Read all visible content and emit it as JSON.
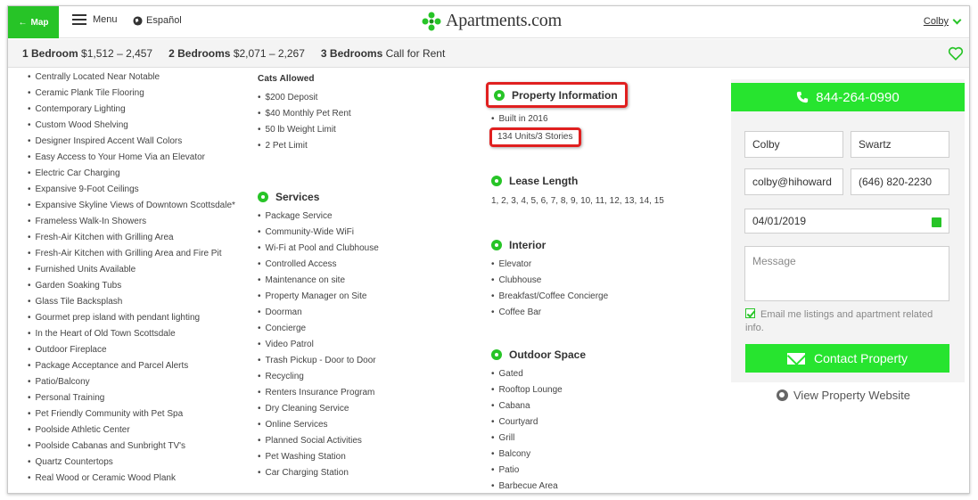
{
  "header": {
    "map_label": "Map",
    "menu_label": "Menu",
    "lang_label": "Español",
    "logo_text": "Apartments.com",
    "user_name": "Colby"
  },
  "pricebar": {
    "items": [
      {
        "label": "1 Bedroom",
        "value": "$1,512 – 2,457"
      },
      {
        "label": "2 Bedrooms",
        "value": "$2,071 – 2,267"
      },
      {
        "label": "3 Bedrooms",
        "value": "Call for Rent"
      }
    ]
  },
  "features": [
    "Centrally Located Near Notable",
    "Ceramic Plank Tile Flooring",
    "Contemporary Lighting",
    "Custom Wood Shelving",
    "Designer Inspired Accent Wall Colors",
    "Easy Access to Your Home Via an Elevator",
    "Electric Car Charging",
    "Expansive 9-Foot Ceilings",
    "Expansive Skyline Views of Downtown Scottsdale*",
    "Frameless Walk-In Showers",
    "Fresh-Air Kitchen with Grilling Area",
    "Fresh-Air Kitchen with Grilling Area and Fire Pit",
    "Furnished Units Available",
    "Garden Soaking Tubs",
    "Glass Tile Backsplash",
    "Gourmet prep island with pendant lighting",
    "In the Heart of Old Town Scottsdale",
    "Outdoor Fireplace",
    "Package Acceptance and Parcel Alerts",
    "Patio/Balcony",
    "Personal Training",
    "Pet Friendly Community with Pet Spa",
    "Poolside Athletic Center",
    "Poolside Cabanas and Sunbright TV's",
    "Quartz Countertops",
    "Real Wood or Ceramic Wood Plank"
  ],
  "cats": {
    "title": "Cats Allowed",
    "items": [
      "$200 Deposit",
      "$40 Monthly Pet Rent",
      "50 lb Weight Limit",
      "2 Pet Limit"
    ]
  },
  "services": {
    "title": "Services",
    "items": [
      "Package Service",
      "Community-Wide WiFi",
      "Wi-Fi at Pool and Clubhouse",
      "Controlled Access",
      "Maintenance on site",
      "Property Manager on Site",
      "Doorman",
      "Concierge",
      "Video Patrol",
      "Trash Pickup - Door to Door",
      "Recycling",
      "Renters Insurance Program",
      "Dry Cleaning Service",
      "Online Services",
      "Planned Social Activities",
      "Pet Washing Station",
      "Car Charging Station"
    ]
  },
  "property_info": {
    "title": "Property Information",
    "built": "Built in 2016",
    "units": "134 Units/3 Stories"
  },
  "lease": {
    "title": "Lease Length",
    "values": "1, 2, 3, 4, 5, 6, 7, 8, 9, 10, 11, 12, 13, 14, 15"
  },
  "interior": {
    "title": "Interior",
    "items": [
      "Elevator",
      "Clubhouse",
      "Breakfast/Coffee Concierge",
      "Coffee Bar"
    ]
  },
  "outdoor": {
    "title": "Outdoor Space",
    "items": [
      "Gated",
      "Rooftop Lounge",
      "Cabana",
      "Courtyard",
      "Grill",
      "Balcony",
      "Patio",
      "Barbecue Area"
    ]
  },
  "contact": {
    "phone": "844-264-0990",
    "first_name": "Colby",
    "last_name": "Swartz",
    "email": "colby@hihoward",
    "phone_field": "(646) 820-2230",
    "date": "04/01/2019",
    "message_placeholder": "Message",
    "opt_in": "Email me listings and apartment related info.",
    "submit": "Contact Property",
    "website": "View Property Website"
  },
  "colors": {
    "brand_green": "#27e42f",
    "highlight_red": "#e02020"
  }
}
